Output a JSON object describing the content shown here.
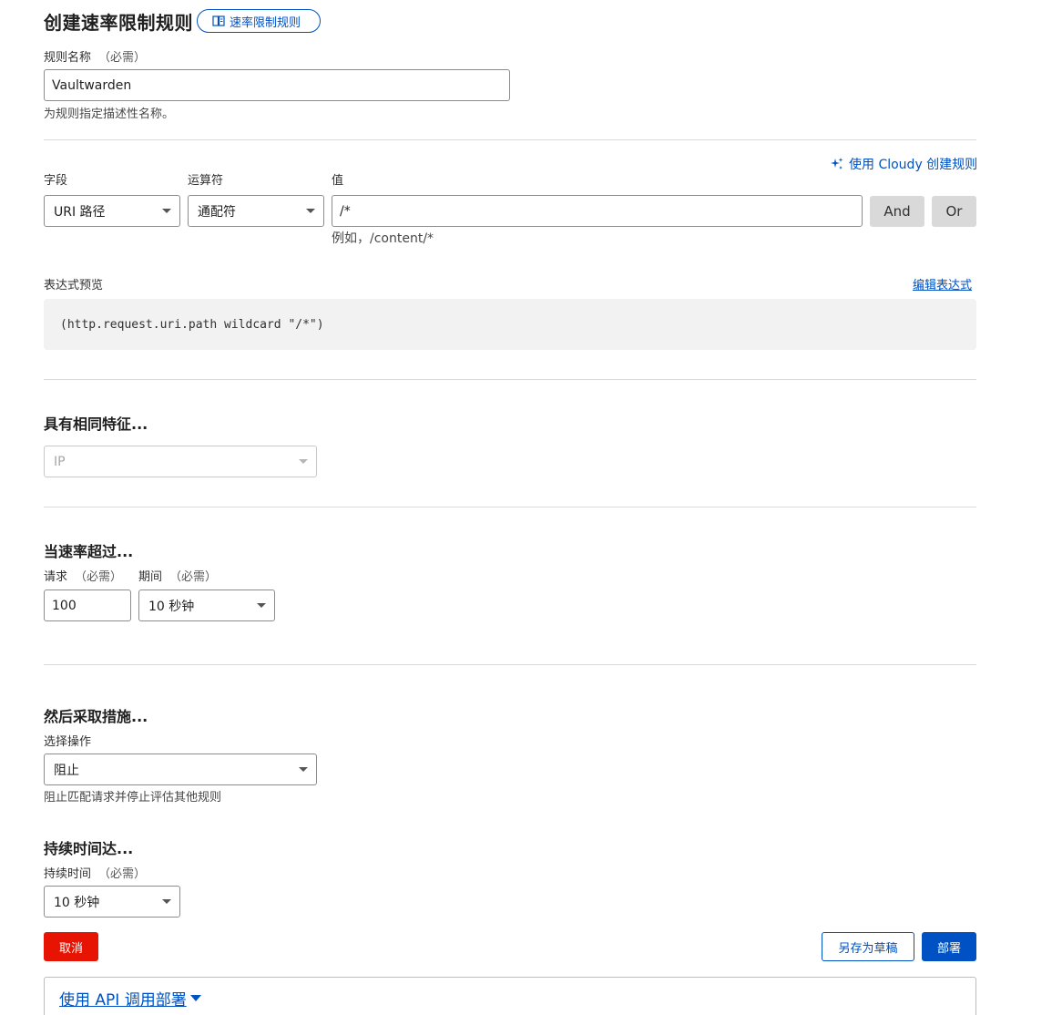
{
  "header": {
    "title": "创建速率限制规则",
    "doc_link": "速率限制规则"
  },
  "rule_name": {
    "label": "规则名称",
    "required": "（必需）",
    "value": "Vaultwarden",
    "hint": "为规则指定描述性名称。"
  },
  "expression_builder": {
    "cloudy_link": "使用 Cloudy 创建规则",
    "field_label": "字段",
    "operator_label": "运算符",
    "value_label": "值",
    "field_value": "URI 路径",
    "operator_value": "通配符",
    "value_input": "/*",
    "value_hint": "例如，/content/*",
    "and_label": "And",
    "or_label": "Or"
  },
  "expression_preview": {
    "label": "表达式预览",
    "edit_link": "编辑表达式",
    "expression": "(http.request.uri.path wildcard \"/*\")"
  },
  "characteristics": {
    "title": "具有相同特征...",
    "value": "IP"
  },
  "rate": {
    "title": "当速率超过...",
    "requests_label": "请求",
    "requests_required": "（必需）",
    "requests_value": "100",
    "period_label": "期间",
    "period_required": "（必需）",
    "period_value": "10 秒钟"
  },
  "action": {
    "title": "然后采取措施...",
    "select_label": "选择操作",
    "value": "阻止",
    "hint": "阻止匹配请求并停止评估其他规则"
  },
  "duration": {
    "title": "持续时间达...",
    "label": "持续时间",
    "required": "（必需）",
    "value": "10 秒钟"
  },
  "footer": {
    "cancel_label": "取消",
    "draft_label": "另存为草稿",
    "deploy_label": "部署",
    "api_link": "使用 API 调用部署"
  },
  "colors": {
    "accent": "#0051c3",
    "danger": "#e81403"
  }
}
